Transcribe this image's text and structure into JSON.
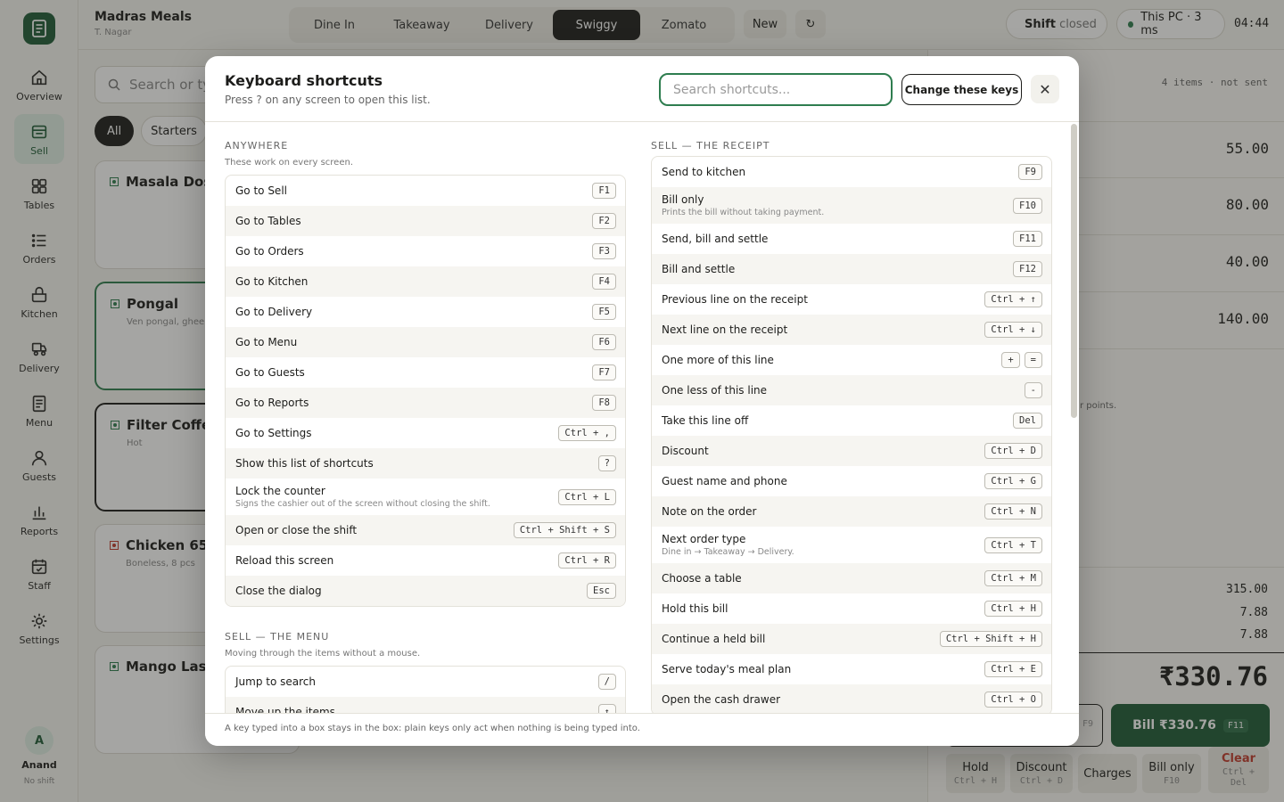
{
  "app": {
    "store_name": "Madras Meals",
    "store_location": "T. Nagar",
    "order_types": [
      "Dine In",
      "Takeaway",
      "Delivery",
      "Swiggy",
      "Zomato"
    ],
    "active_order_type": "Swiggy",
    "new_label": "New",
    "refresh_glyph": "↻",
    "shift_label": "Shift",
    "shift_status": "closed",
    "device_status": "This PC · 3 ms",
    "clock": "04:44",
    "colors": {
      "brand": "#1e5a36",
      "accent": "#2e7d4f",
      "nonveg": "#c0392b"
    }
  },
  "sidebar": {
    "items": [
      {
        "label": "Overview",
        "icon": "home-icon"
      },
      {
        "label": "Sell",
        "icon": "register-icon"
      },
      {
        "label": "Tables",
        "icon": "grid-icon"
      },
      {
        "label": "Orders",
        "icon": "list-icon"
      },
      {
        "label": "Kitchen",
        "icon": "pot-icon"
      },
      {
        "label": "Delivery",
        "icon": "scooter-icon"
      },
      {
        "label": "Menu",
        "icon": "menu-book-icon"
      },
      {
        "label": "Guests",
        "icon": "person-icon"
      },
      {
        "label": "Reports",
        "icon": "bar-chart-icon"
      },
      {
        "label": "Staff",
        "icon": "calendar-check-icon"
      },
      {
        "label": "Settings",
        "icon": "gear-icon"
      }
    ],
    "active": "Sell",
    "user_initial": "A",
    "user_name": "Anand",
    "user_shift": "No shift"
  },
  "menu_area": {
    "search_placeholder": "Search or typ",
    "chips": [
      "All",
      "Starters"
    ],
    "cards": [
      {
        "name": "Masala Dosa",
        "sub": "",
        "veg": true
      },
      {
        "name": "Pongal",
        "sub": "Ven pongal, ghee",
        "veg": true
      },
      {
        "name": "Filter Coffee",
        "sub": "Hot",
        "veg": true
      },
      {
        "name": "Chicken 65",
        "sub": "Boneless, 8 pcs",
        "veg": false
      },
      {
        "name": "Mango Lassi",
        "sub": "",
        "veg": true
      }
    ]
  },
  "receipt": {
    "items_status": "4 items · not sent",
    "line_amounts": [
      "55.00",
      "80.00",
      "40.00",
      "140.00"
    ],
    "points_fragment": "r points.",
    "subtotal": "315.00",
    "tax1": "7.88",
    "tax2": "7.88",
    "total": "₹330.76",
    "hold_key_fragment": "F9",
    "bill_button": "Bill ₹330.76",
    "bill_key": "F11",
    "actions": [
      {
        "label": "Hold",
        "key": "Ctrl + H"
      },
      {
        "label": "Discount",
        "key": "Ctrl + D"
      },
      {
        "label": "Charges",
        "key": ""
      },
      {
        "label": "Bill only",
        "key": "F10"
      },
      {
        "label": "Clear",
        "key": "Ctrl +\nDel"
      }
    ]
  },
  "dialog": {
    "title": "Keyboard shortcuts",
    "subtitle": "Press ? on any screen to open this list.",
    "search_placeholder": "Search shortcuts...",
    "change_keys": "Change these keys",
    "close_glyph": "✕",
    "footer": "A key typed into a box stays in the box: plain keys only act when nothing is being typed into.",
    "sections": {
      "anywhere": {
        "title": "ANYWHERE",
        "subtitle": "These work on every screen.",
        "rows": [
          {
            "label": "Go to Sell",
            "keys": [
              "F1"
            ]
          },
          {
            "label": "Go to Tables",
            "keys": [
              "F2"
            ]
          },
          {
            "label": "Go to Orders",
            "keys": [
              "F3"
            ]
          },
          {
            "label": "Go to Kitchen",
            "keys": [
              "F4"
            ]
          },
          {
            "label": "Go to Delivery",
            "keys": [
              "F5"
            ]
          },
          {
            "label": "Go to Menu",
            "keys": [
              "F6"
            ]
          },
          {
            "label": "Go to Guests",
            "keys": [
              "F7"
            ]
          },
          {
            "label": "Go to Reports",
            "keys": [
              "F8"
            ]
          },
          {
            "label": "Go to Settings",
            "keys": [
              "Ctrl + ,"
            ]
          },
          {
            "label": "Show this list of shortcuts",
            "keys": [
              "?"
            ]
          },
          {
            "label": "Lock the counter",
            "desc": "Signs the cashier out of the screen without closing the shift.",
            "keys": [
              "Ctrl + L"
            ]
          },
          {
            "label": "Open or close the shift",
            "keys": [
              "Ctrl + Shift + S"
            ]
          },
          {
            "label": "Reload this screen",
            "keys": [
              "Ctrl + R"
            ]
          },
          {
            "label": "Close the dialog",
            "keys": [
              "Esc"
            ]
          }
        ]
      },
      "menu": {
        "title": "SELL — THE MENU",
        "subtitle": "Moving through the items without a mouse.",
        "rows": [
          {
            "label": "Jump to search",
            "keys": [
              "/"
            ]
          },
          {
            "label": "Move up the items",
            "keys": [
              "↑"
            ]
          }
        ]
      },
      "receipt": {
        "title": "SELL — THE RECEIPT",
        "rows": [
          {
            "label": "Send to kitchen",
            "keys": [
              "F9"
            ]
          },
          {
            "label": "Bill only",
            "desc": "Prints the bill without taking payment.",
            "keys": [
              "F10"
            ]
          },
          {
            "label": "Send, bill and settle",
            "keys": [
              "F11"
            ]
          },
          {
            "label": "Bill and settle",
            "keys": [
              "F12"
            ]
          },
          {
            "label": "Previous line on the receipt",
            "keys": [
              "Ctrl + ↑"
            ]
          },
          {
            "label": "Next line on the receipt",
            "keys": [
              "Ctrl + ↓"
            ]
          },
          {
            "label": "One more of this line",
            "keys": [
              "+",
              "="
            ]
          },
          {
            "label": "One less of this line",
            "keys": [
              "-"
            ]
          },
          {
            "label": "Take this line off",
            "keys": [
              "Del"
            ]
          },
          {
            "label": "Discount",
            "keys": [
              "Ctrl + D"
            ]
          },
          {
            "label": "Guest name and phone",
            "keys": [
              "Ctrl + G"
            ]
          },
          {
            "label": "Note on the order",
            "keys": [
              "Ctrl + N"
            ]
          },
          {
            "label": "Next order type",
            "desc": "Dine in → Takeaway → Delivery.",
            "keys": [
              "Ctrl + T"
            ]
          },
          {
            "label": "Choose a table",
            "keys": [
              "Ctrl + M"
            ]
          },
          {
            "label": "Hold this bill",
            "keys": [
              "Ctrl + H"
            ]
          },
          {
            "label": "Continue a held bill",
            "keys": [
              "Ctrl + Shift + H"
            ]
          },
          {
            "label": "Serve today's meal plan",
            "keys": [
              "Ctrl + E"
            ]
          },
          {
            "label": "Open the cash drawer",
            "keys": [
              "Ctrl + O"
            ]
          }
        ]
      }
    }
  }
}
